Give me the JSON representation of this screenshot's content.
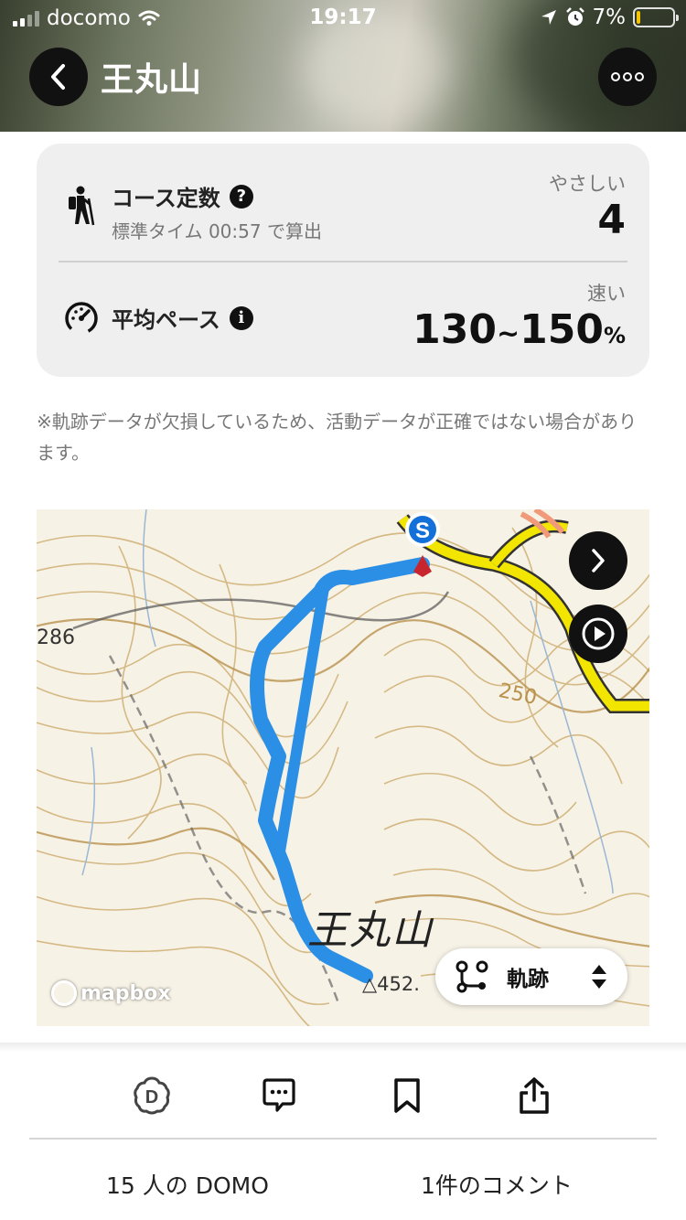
{
  "status_bar": {
    "carrier": "docomo",
    "time": "19:17",
    "battery": "7%",
    "battery_level": 0.07
  },
  "header": {
    "title": "王丸山",
    "back_icon": "chevron-left-icon",
    "more_icon": "more-dots-icon"
  },
  "course": {
    "label": "コース定数",
    "standard_time_text": "標準タイム 00:57 で算出",
    "level": "やさしい",
    "value": "4"
  },
  "pace": {
    "label": "平均ペース",
    "level": "速い",
    "value_low": "130",
    "value_high": "150",
    "tilde": "~",
    "unit": "%"
  },
  "notice": "※軌跡データが欠損しているため、活動データが正確ではない場合があります。",
  "map": {
    "elevation_label_left": "286",
    "elevation_label_right": "250",
    "summit_name": "王丸山",
    "peak_label": "△452.",
    "start_marker": "S",
    "attribution": "mapbox",
    "track_button_label": "軌跡",
    "colors": {
      "track": "#2b8fe6",
      "road": "#f2e600",
      "contour": "#c9a96a"
    }
  },
  "actions": {
    "icons": [
      "domo-icon",
      "comment-icon",
      "bookmark-icon",
      "share-icon"
    ]
  },
  "counts": {
    "domo": "15 人の DOMO",
    "comments": "1件のコメント"
  }
}
